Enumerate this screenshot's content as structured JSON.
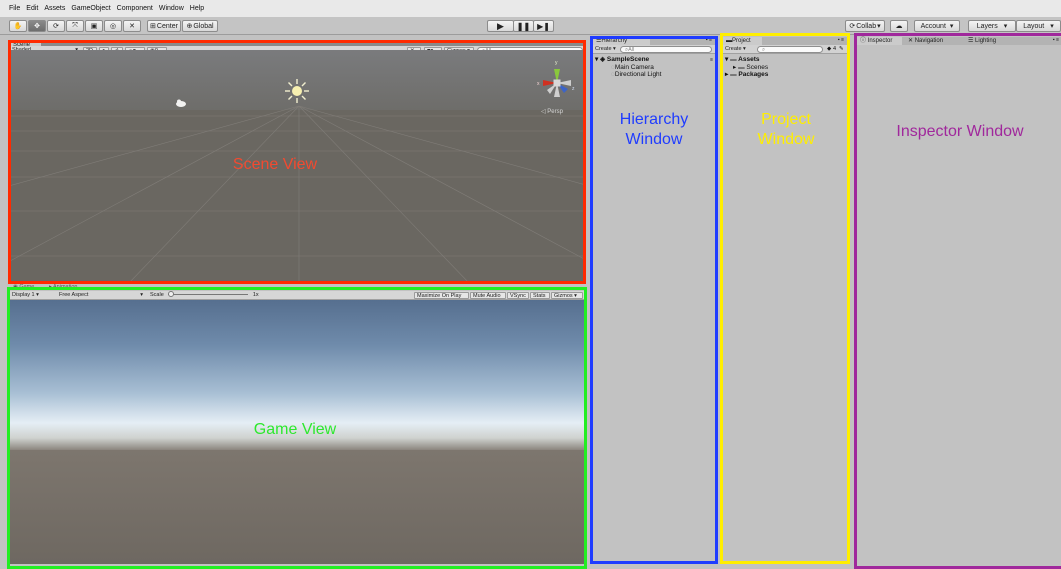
{
  "menu": [
    "File",
    "Edit",
    "Assets",
    "GameObject",
    "Component",
    "Window",
    "Help"
  ],
  "toolbar": {
    "pivot": "Center",
    "space": "Global",
    "collab": "Collab",
    "account": "Account",
    "layers": "Layers",
    "layout": "Layout"
  },
  "scene": {
    "tab": "Scene",
    "shading": "Shaded",
    "mode2d": "2D",
    "fx_count": "0",
    "gizmos": "Gizmos",
    "search_placeholder": "All",
    "persp": "Persp",
    "axes": {
      "y": "y",
      "x": "x",
      "z": "z"
    }
  },
  "game": {
    "tab": "Game",
    "tab2": "Animation",
    "display": "Display 1",
    "aspect": "Free Aspect",
    "scale_label": "Scale",
    "scale_value": "1x",
    "maximize": "Maximize On Play",
    "mute": "Mute Audio",
    "vsync": "VSync",
    "stats": "Stats",
    "gizmos": "Gizmos"
  },
  "hierarchy": {
    "tab": "Hierarchy",
    "create": "Create",
    "search_placeholder": "All",
    "scene_name": "SampleScene",
    "items": [
      "Main Camera",
      "Directional Light"
    ]
  },
  "project": {
    "tab": "Project",
    "create": "Create",
    "badge": "4",
    "assets": "Assets",
    "scenes": "Scenes",
    "packages": "Packages"
  },
  "inspector": {
    "tabs": [
      "Inspector",
      "Navigation",
      "Lighting"
    ]
  },
  "annotations": {
    "scene": "Scene View",
    "game": "Game View",
    "hierarchy": [
      "Hierarchy",
      "Window"
    ],
    "project": [
      "Project",
      "Window"
    ],
    "inspector": "Inspector Window"
  },
  "colors": {
    "scene_frame": "#ff2a00",
    "game_frame": "#22ee22",
    "hierarchy_frame": "#1f3cff",
    "project_frame": "#ffee00",
    "inspector_frame": "#a0289c"
  }
}
